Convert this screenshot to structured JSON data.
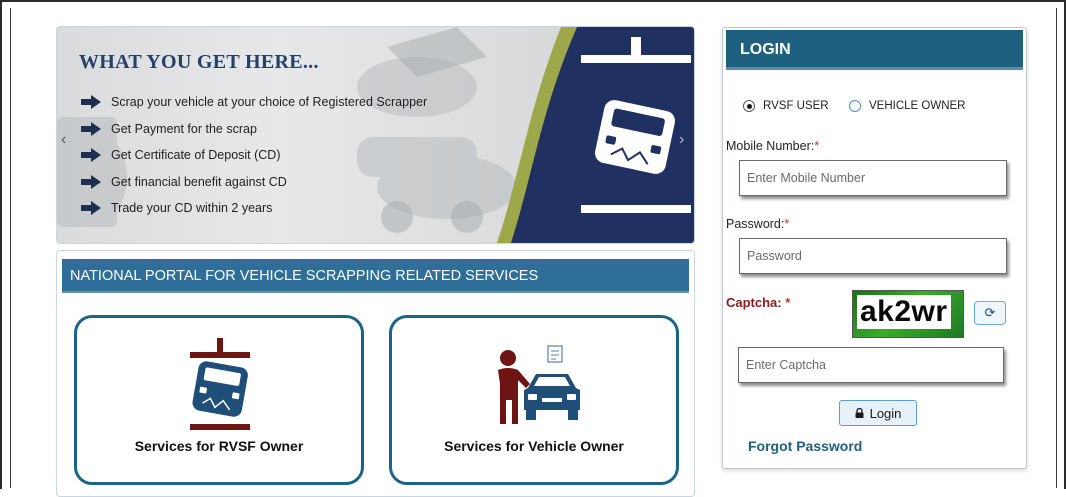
{
  "carousel": {
    "title": "WHAT YOU GET HERE...",
    "features": [
      "Scrap your vehicle at your choice of Registered Scrapper",
      "Get Payment for the scrap",
      "Get Certificate of Deposit (CD)",
      "Get financial benefit against CD",
      "Trade your CD within 2 years"
    ],
    "prev_glyph": "‹",
    "next_glyph": "›",
    "colors": {
      "title": "#24406b",
      "navy": "#203060",
      "accent": "#9ea84a"
    }
  },
  "services": {
    "header": "NATIONAL PORTAL FOR VEHICLE SCRAPPING RELATED SERVICES",
    "cards": [
      {
        "label": "Services for RVSF Owner",
        "icon": "car-crusher-icon"
      },
      {
        "label": "Services for Vehicle Owner",
        "icon": "vehicle-owner-icon"
      }
    ]
  },
  "login": {
    "title": "LOGIN",
    "user_types": [
      {
        "label": "RVSF USER",
        "selected": true
      },
      {
        "label": "VEHICLE OWNER",
        "selected": false
      }
    ],
    "mobile_label": "Mobile Number:",
    "mobile_placeholder": "Enter Mobile Number",
    "password_label": "Password:",
    "password_placeholder": "Password",
    "captcha_label": "Captcha:",
    "required_mark": "*",
    "captcha_text": "ak2wr",
    "captcha_placeholder": "Enter Captcha",
    "refresh_icon": "refresh-icon",
    "login_button": "Login",
    "lock_icon": "lock-icon",
    "forgot_password": "Forgot Password"
  }
}
